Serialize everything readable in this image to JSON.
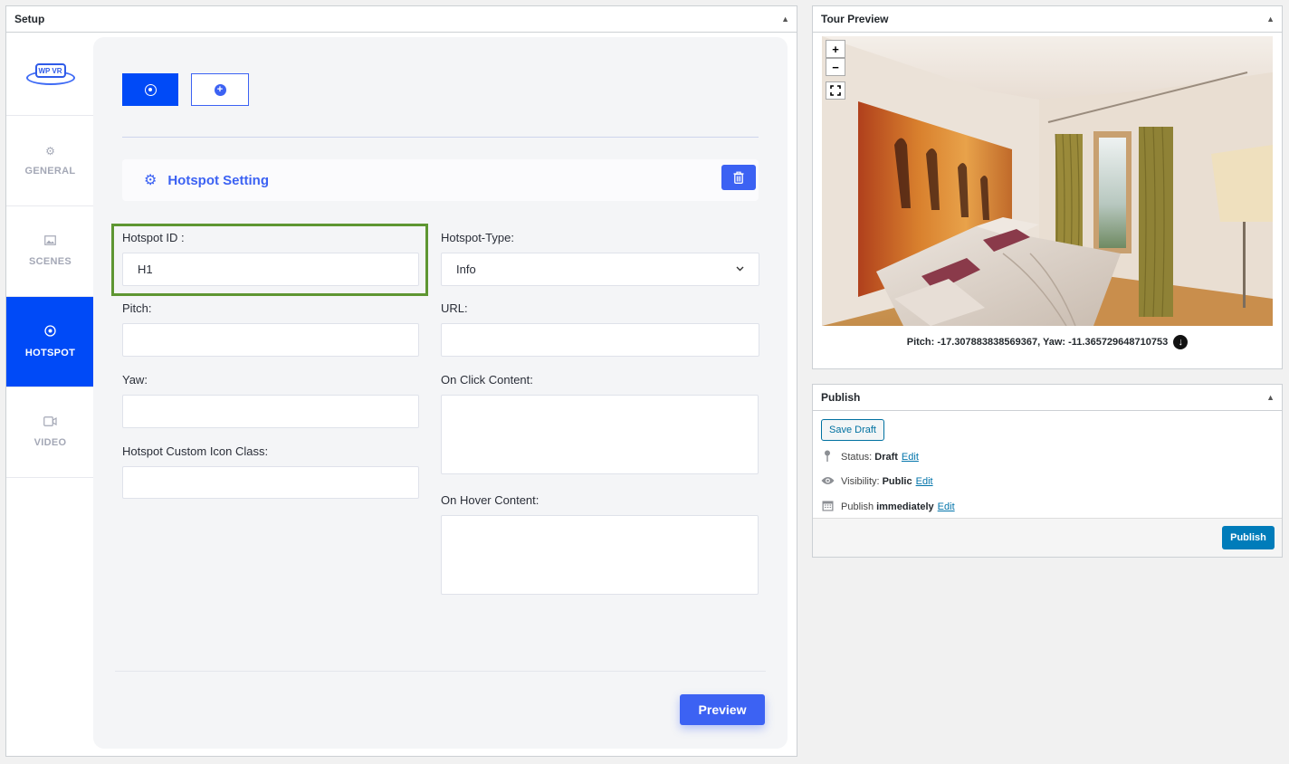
{
  "setup": {
    "title": "Setup",
    "logo_text": "WP VR",
    "nav": [
      {
        "label": "GENERAL",
        "icon": "gear-icon"
      },
      {
        "label": "SCENES",
        "icon": "image-icon"
      },
      {
        "label": "HOTSPOT",
        "icon": "target-icon",
        "active": true
      },
      {
        "label": "VIDEO",
        "icon": "video-icon"
      }
    ],
    "hotspot_setting_title": "Hotspot Setting",
    "fields": {
      "hotspot_id": {
        "label": "Hotspot ID :",
        "value": "H1"
      },
      "hotspot_type": {
        "label": "Hotspot-Type:",
        "value": "Info"
      },
      "pitch": {
        "label": "Pitch:",
        "value": ""
      },
      "url": {
        "label": "URL:",
        "value": ""
      },
      "yaw": {
        "label": "Yaw:",
        "value": ""
      },
      "on_click": {
        "label": "On Click Content:",
        "value": ""
      },
      "custom_icon": {
        "label": "Hotspot Custom Icon Class:",
        "value": ""
      },
      "on_hover": {
        "label": "On Hover Content:",
        "value": ""
      }
    },
    "preview_label": "Preview"
  },
  "tour_preview": {
    "title": "Tour Preview",
    "controls": {
      "zoom_in": "+",
      "zoom_out": "−"
    },
    "coords_text": "Pitch: -17.307883838569367, Yaw: -11.365729648710753"
  },
  "publish": {
    "title": "Publish",
    "save_draft": "Save Draft",
    "status_label": "Status:",
    "status_value": "Draft",
    "visibility_label": "Visibility:",
    "visibility_value": "Public",
    "publish_label": "Publish",
    "publish_value": "immediately",
    "edit": "Edit",
    "publish_button": "Publish"
  },
  "colors": {
    "accent": "#004af7",
    "button_blue": "#3c62f3",
    "wp_blue": "#007cba",
    "highlight": "#5e9632"
  }
}
